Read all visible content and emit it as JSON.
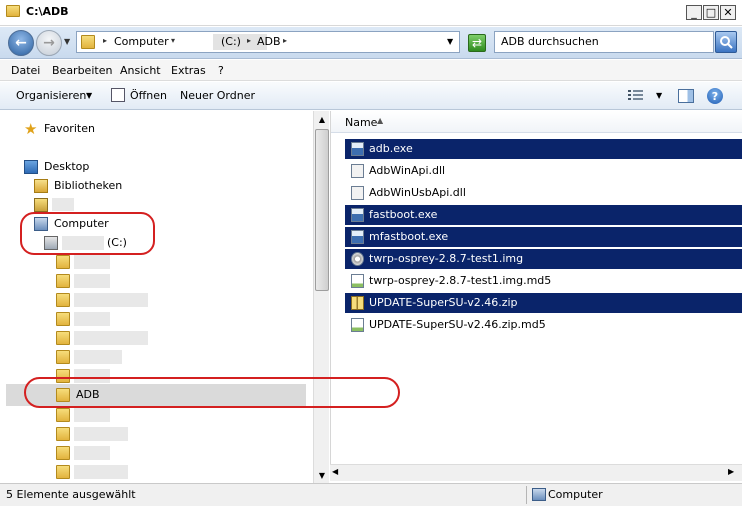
{
  "window": {
    "title": "C:\\ADB",
    "min_glyph": "_",
    "max_glyph": "□",
    "close_glyph": "✕"
  },
  "address_bar": {
    "crumbs": [
      "Computer",
      "(C:)",
      "ADB"
    ],
    "search_placeholder": "ADB durchsuchen"
  },
  "menu": [
    "Datei",
    "Bearbeiten",
    "Ansicht",
    "Extras",
    "?"
  ],
  "toolbar": {
    "organize": "Organisieren",
    "open": "Öffnen",
    "new_folder": "Neuer Ordner"
  },
  "nav": {
    "favorites": "Favoriten",
    "desktop": "Desktop",
    "libraries": "Bibliotheken",
    "computer": "Computer",
    "drive": "(C:)",
    "adb_folder": "ADB"
  },
  "file_list": {
    "column_name": "Name",
    "files": [
      {
        "name": "adb.exe",
        "type": "exe",
        "selected": true
      },
      {
        "name": "AdbWinApi.dll",
        "type": "dll",
        "selected": false
      },
      {
        "name": "AdbWinUsbApi.dll",
        "type": "dll",
        "selected": false
      },
      {
        "name": "fastboot.exe",
        "type": "exe",
        "selected": true
      },
      {
        "name": "mfastboot.exe",
        "type": "exe",
        "selected": true
      },
      {
        "name": "twrp-osprey-2.8.7-test1.img",
        "type": "img",
        "selected": true
      },
      {
        "name": "twrp-osprey-2.8.7-test1.img.md5",
        "type": "md5",
        "selected": false
      },
      {
        "name": "UPDATE-SuperSU-v2.46.zip",
        "type": "zip",
        "selected": true
      },
      {
        "name": "UPDATE-SuperSU-v2.46.zip.md5",
        "type": "md5",
        "selected": false
      }
    ]
  },
  "status": {
    "selection": "5 Elemente ausgewählt",
    "location": "Computer"
  },
  "colors": {
    "selection": "#0a246a",
    "annotation": "#d42020"
  }
}
